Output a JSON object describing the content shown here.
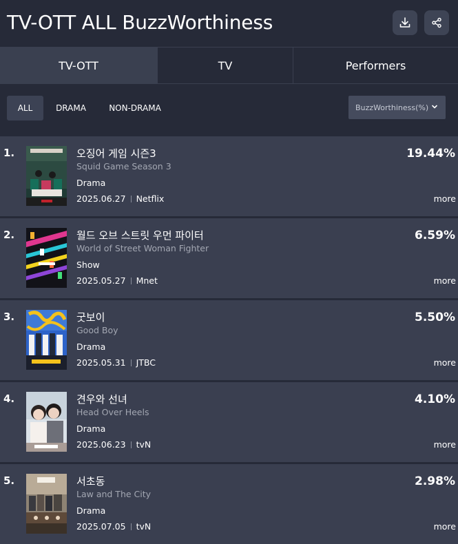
{
  "header": {
    "title": "TV-OTT ALL BuzzWorthiness",
    "download_icon": "download-icon",
    "share_icon": "share-icon"
  },
  "tabs": [
    {
      "label": "TV-OTT",
      "active": true
    },
    {
      "label": "TV",
      "active": false
    },
    {
      "label": "Performers",
      "active": false
    }
  ],
  "filters": {
    "chips": [
      {
        "label": "ALL",
        "active": true
      },
      {
        "label": "DRAMA",
        "active": false
      },
      {
        "label": "NON-DRAMA",
        "active": false
      }
    ],
    "sort": {
      "selected": "BuzzWorthiness(%)",
      "icon": "chevron-down-icon"
    }
  },
  "rankings": [
    {
      "rank": "1.",
      "title_kr": "오징어 게임 시즌3",
      "title_en": "Squid Game Season 3",
      "genre": "Drama",
      "date": "2025.06.27",
      "channel": "Netflix",
      "percent": "19.44%",
      "more": "more"
    },
    {
      "rank": "2.",
      "title_kr": "월드 오브 스트릿 우먼 파이터",
      "title_en": "World of Street Woman Fighter",
      "genre": "Show",
      "date": "2025.05.27",
      "channel": "Mnet",
      "percent": "6.59%",
      "more": "more"
    },
    {
      "rank": "3.",
      "title_kr": "굿보이",
      "title_en": "Good Boy",
      "genre": "Drama",
      "date": "2025.05.31",
      "channel": "JTBC",
      "percent": "5.50%",
      "more": "more"
    },
    {
      "rank": "4.",
      "title_kr": "견우와 선녀",
      "title_en": "Head Over Heels",
      "genre": "Drama",
      "date": "2025.06.23",
      "channel": "tvN",
      "percent": "4.10%",
      "more": "more"
    },
    {
      "rank": "5.",
      "title_kr": "서초동",
      "title_en": "Law and The City",
      "genre": "Drama",
      "date": "2025.07.05",
      "channel": "tvN",
      "percent": "2.98%",
      "more": "more"
    }
  ]
}
